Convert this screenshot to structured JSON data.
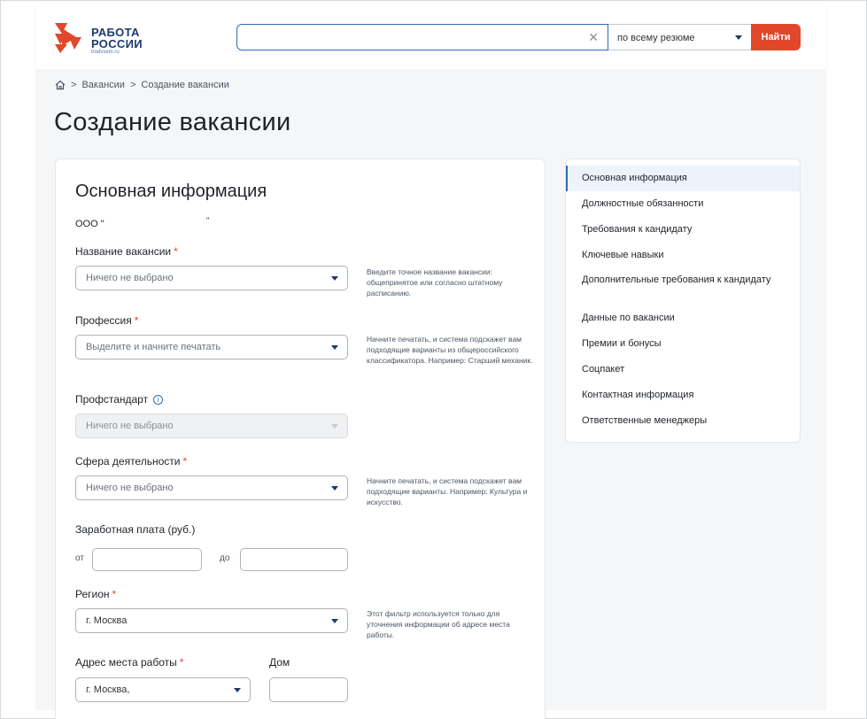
{
  "logo": {
    "line1": "РАБОТА",
    "line2": "РОССИИ",
    "line3": "trudvsem.ru"
  },
  "header": {
    "search_value": "",
    "search_clear": "✕",
    "scope": "по всему резюме",
    "find_button": "Найти"
  },
  "breadcrumb": {
    "sep": ">",
    "item1": "Вакансии",
    "item2": "Создание вакансии"
  },
  "page_title": "Создание вакансии",
  "form": {
    "section_title": "Основная информация",
    "org_name": "ООО \"",
    "org_star": "\"",
    "required_mark": "*",
    "vacancy_name": {
      "label": "Название вакансии",
      "value": "Ничего не выбрано",
      "hint": "Введите точное название вакансии: общепринятое или согласно штатному расписанию."
    },
    "profession": {
      "label": "Профессия",
      "value": "Выделите и начните печатать",
      "hint": "Начните печатать, и система подскажет вам подходящие варианты из общероссийского классификатора. Например: Старший механик."
    },
    "prof_standard": {
      "label": "Профстандарт",
      "info": "i",
      "value": "Ничего не выбрано"
    },
    "activity_sphere": {
      "label": "Сфера деятельности",
      "value": "Ничего не выбрано",
      "hint": "Начните печатать, и система подскажет вам подходящие варианты. Например: Культура и искусство."
    },
    "salary": {
      "label": "Заработная плата (руб.)",
      "from": "от",
      "to": "до"
    },
    "region": {
      "label": "Регион",
      "value": "г. Москва",
      "hint": "Этот фильтр используется только для уточнения информации об адресе места работы."
    },
    "address": {
      "label": "Адрес места работы",
      "value": "г. Москва,"
    },
    "house": {
      "label": "Дом"
    }
  },
  "nav": {
    "items": [
      {
        "label": "Основная информация"
      },
      {
        "label": "Должностные обязанности"
      },
      {
        "label": "Требования к кандидату"
      },
      {
        "label": "Ключевые навыки"
      },
      {
        "label": "Дополнительные требования к кандидату"
      },
      {
        "label": "Данные по вакансии"
      },
      {
        "label": "Премии и бонусы"
      },
      {
        "label": "Соцпакет"
      },
      {
        "label": "Контактная информация"
      },
      {
        "label": "Ответственные менеджеры"
      }
    ]
  },
  "colors": {
    "accent": "#2e6db3",
    "brand_red": "#e0472b",
    "logo_navy": "#1d3a6d"
  }
}
